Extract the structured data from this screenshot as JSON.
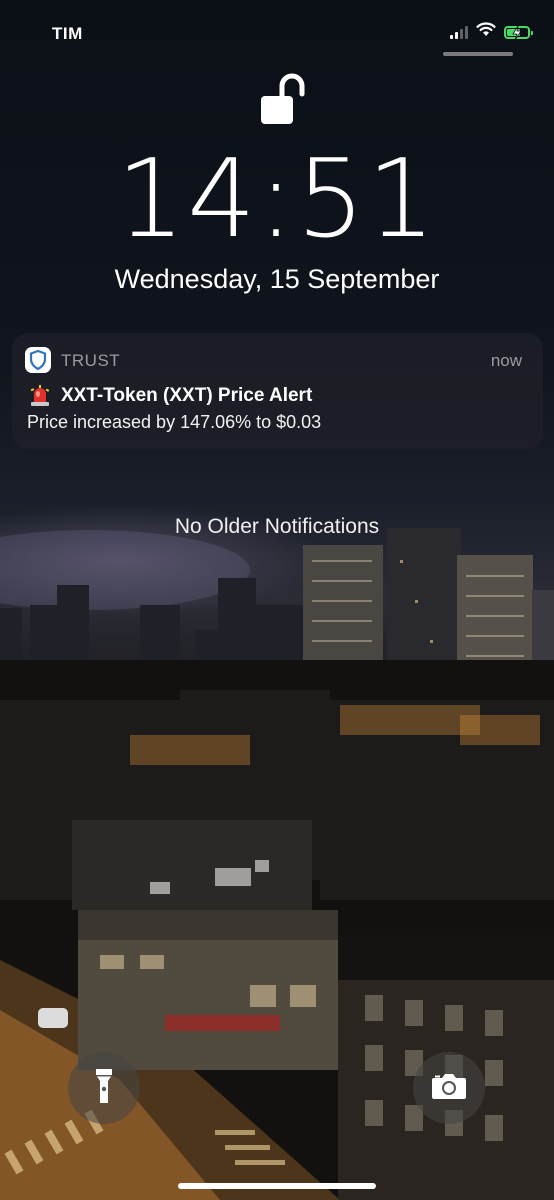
{
  "status_bar": {
    "carrier": "TIM",
    "signal_bars": 4,
    "signal_active": 2,
    "wifi_icon": "wifi-icon",
    "battery_icon": "battery-charging-icon",
    "battery_color": "#4cd964"
  },
  "lock_screen": {
    "lock_state": "unlocked",
    "time": "14:51",
    "date": "Wednesday, 15 September"
  },
  "notification": {
    "app_icon": "shield-icon",
    "app_name": "TRUST",
    "time": "now",
    "title_icon": "police-light-emoji",
    "title": "XXT-Token (XXT) Price Alert",
    "body": "Price increased by 147.06% to $0.03"
  },
  "no_older_notifications": "No Older Notifications",
  "quick_actions": {
    "left_icon": "flashlight-icon",
    "right_icon": "camera-icon"
  }
}
